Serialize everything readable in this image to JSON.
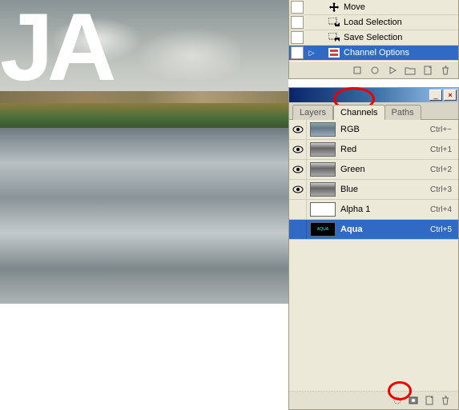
{
  "canvas": {
    "text": "JA"
  },
  "actions": {
    "items": [
      {
        "label": "Move"
      },
      {
        "label": "Load Selection"
      },
      {
        "label": "Save Selection"
      },
      {
        "label": "Channel Options"
      }
    ]
  },
  "tabs": {
    "layers": "Layers",
    "channels": "Channels",
    "paths": "Paths"
  },
  "channels": {
    "items": [
      {
        "name": "RGB",
        "key": "Ctrl+~",
        "visible": true,
        "thumb": "rgb"
      },
      {
        "name": "Red",
        "key": "Ctrl+1",
        "visible": true,
        "thumb": "gray"
      },
      {
        "name": "Green",
        "key": "Ctrl+2",
        "visible": true,
        "thumb": "gray"
      },
      {
        "name": "Blue",
        "key": "Ctrl+3",
        "visible": true,
        "thumb": "gray"
      },
      {
        "name": "Alpha 1",
        "key": "Ctrl+4",
        "visible": false,
        "thumb": "white"
      },
      {
        "name": "Aqua",
        "key": "Ctrl+5",
        "visible": false,
        "thumb": "aqua",
        "selected": true
      }
    ]
  },
  "aqua_thumb_text": "AQUA"
}
